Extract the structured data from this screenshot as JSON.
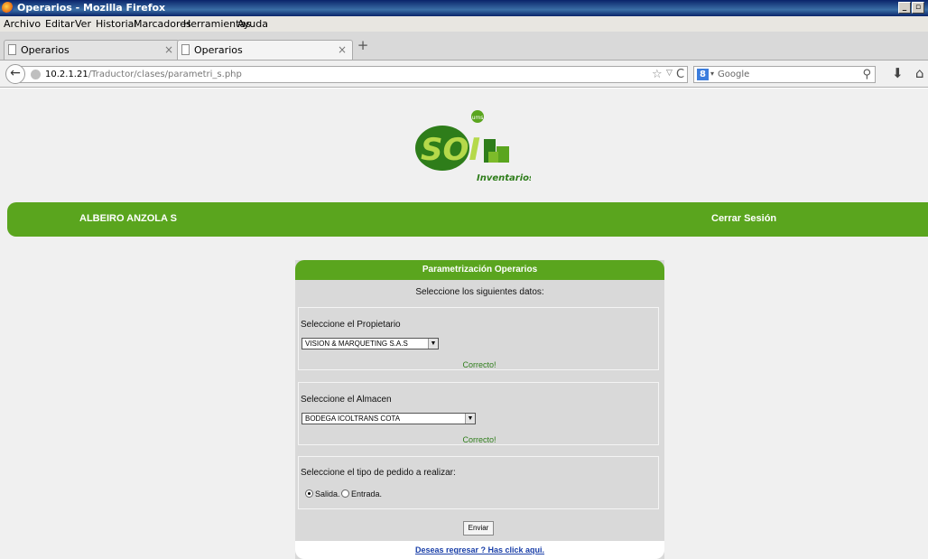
{
  "window": {
    "title": "Operarios - Mozilla Firefox",
    "min": "_",
    "restore": "▫"
  },
  "menu": [
    "Archivo",
    "Editar",
    "Ver",
    "Historial",
    "Marcadores",
    "Herramientas",
    "Ayuda"
  ],
  "tabs": [
    {
      "label": "Operarios",
      "close": "×"
    },
    {
      "label": "Operarios",
      "close": "×"
    }
  ],
  "newtab": "+",
  "nav": {
    "back": "←",
    "url_host": "10.2.1.21",
    "url_path": "/Traductor/clases/parametri_s.php",
    "search_placeholder": "Google",
    "search_engine": "8"
  },
  "logo": {
    "badge": "ums",
    "text": "SOI",
    "subtitle": "Inventarios"
  },
  "header": {
    "user": "ALBEIRO ANZOLA S",
    "logout": "Cerrar Sesión"
  },
  "form": {
    "title": "Parametrización Operarios",
    "subtitle": "Seleccione los siguientes datos:",
    "propietario_label": "Seleccione el Propietario",
    "propietario_value": "VISION & MARQUETING S.A.S",
    "propietario_status": "Correcto!",
    "almacen_label": "Seleccione el Almacen",
    "almacen_value": "BODEGA ICOLTRANS COTA",
    "almacen_status": "Correcto!",
    "tipo_label": "Seleccione el tipo de pedido a realizar:",
    "salida_label": "Salida.",
    "entrada_label": "Entrada.",
    "submit_label": "Enviar",
    "back_link": "Deseas regresar ? Has click aqui."
  },
  "colors": {
    "brand_green": "#5aa51e",
    "panel_gray": "#d9d9d9",
    "link_blue": "#1a3fa8"
  }
}
